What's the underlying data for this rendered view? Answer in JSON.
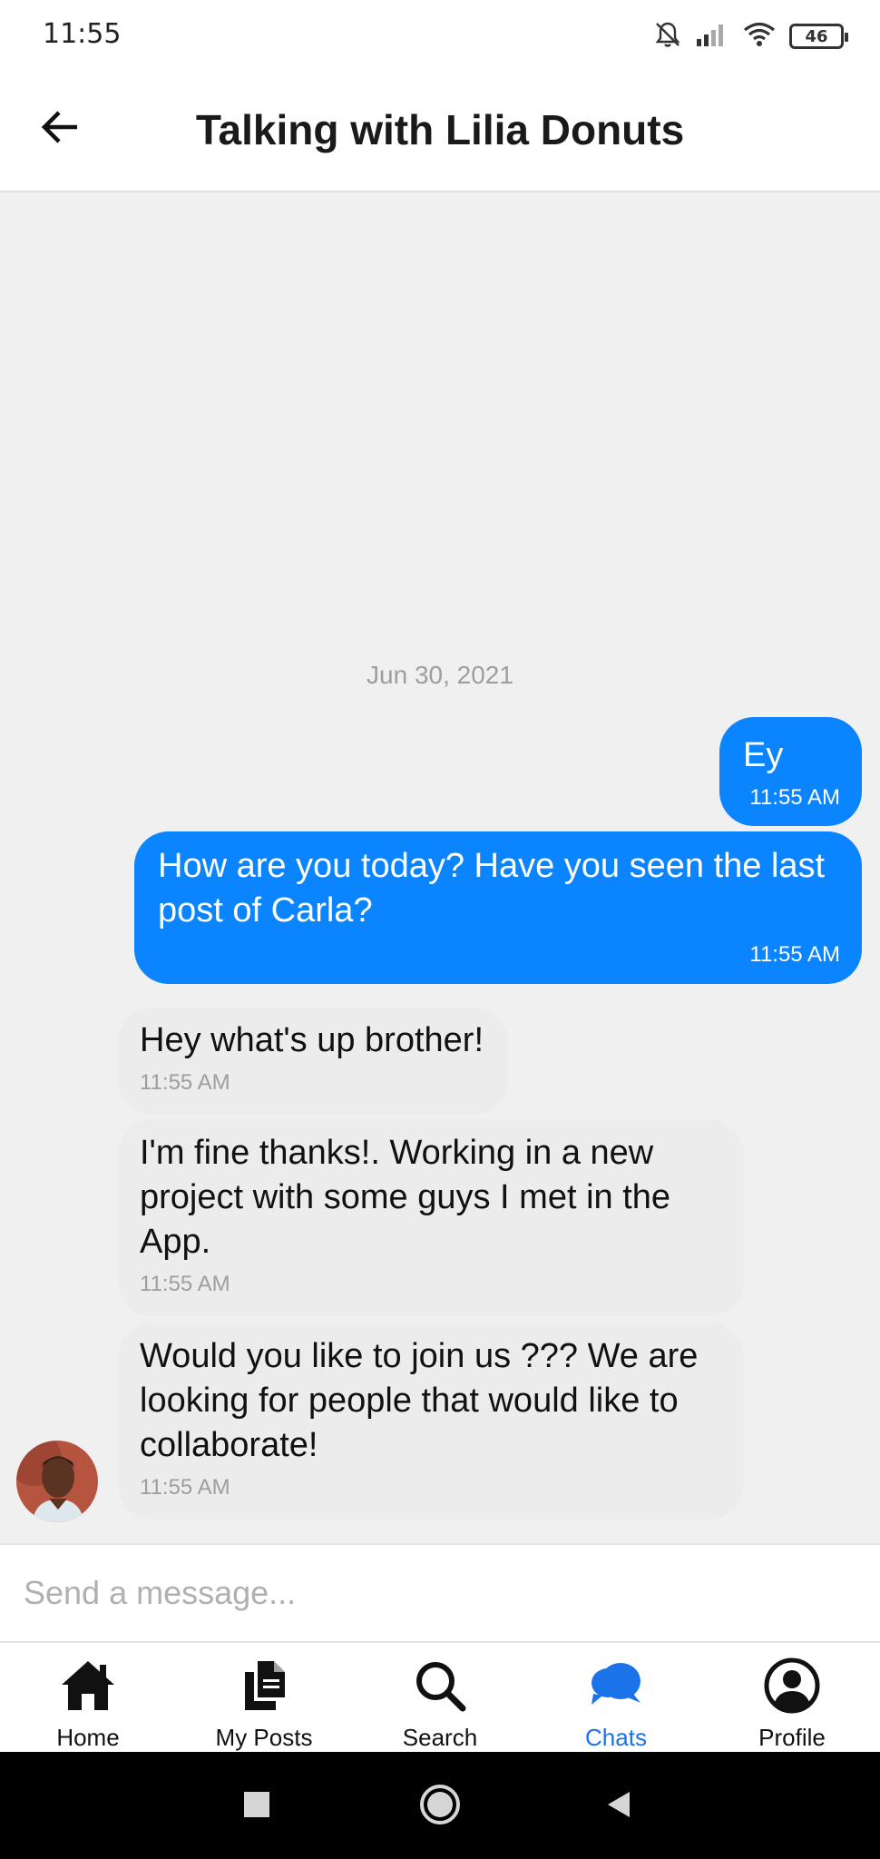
{
  "status_bar": {
    "time": "11:55",
    "battery": "46"
  },
  "header": {
    "title": "Talking with Lilia Donuts"
  },
  "chat": {
    "date": "Jun 30, 2021",
    "messages": [
      {
        "from": "me",
        "text": "Ey",
        "time": "11:55 AM"
      },
      {
        "from": "me",
        "text": "How are you today? Have you seen the last post of Carla?",
        "time": "11:55 AM"
      },
      {
        "from": "them",
        "text": "Hey what's up brother!",
        "time": "11:55 AM"
      },
      {
        "from": "them",
        "text": "I'm fine thanks!. Working in a new project with some guys I met in the App.",
        "time": "11:55 AM"
      },
      {
        "from": "them",
        "text": "Would you like to join us ??? We are looking for people that would like to collaborate!",
        "time": "11:55 AM"
      }
    ]
  },
  "composer": {
    "placeholder": "Send a message..."
  },
  "nav": {
    "items": [
      {
        "label": "Home",
        "icon": "home-icon"
      },
      {
        "label": "My Posts",
        "icon": "documents-icon"
      },
      {
        "label": "Search",
        "icon": "search-icon"
      },
      {
        "label": "Chats",
        "icon": "chat-bubbles-icon"
      },
      {
        "label": "Profile",
        "icon": "account-circle-icon"
      }
    ],
    "active": "Chats"
  },
  "colors": {
    "accent": "#0a84ff",
    "active_nav": "#1a73e8",
    "incoming_bubble": "#ececec",
    "background": "#f0f0f0"
  }
}
